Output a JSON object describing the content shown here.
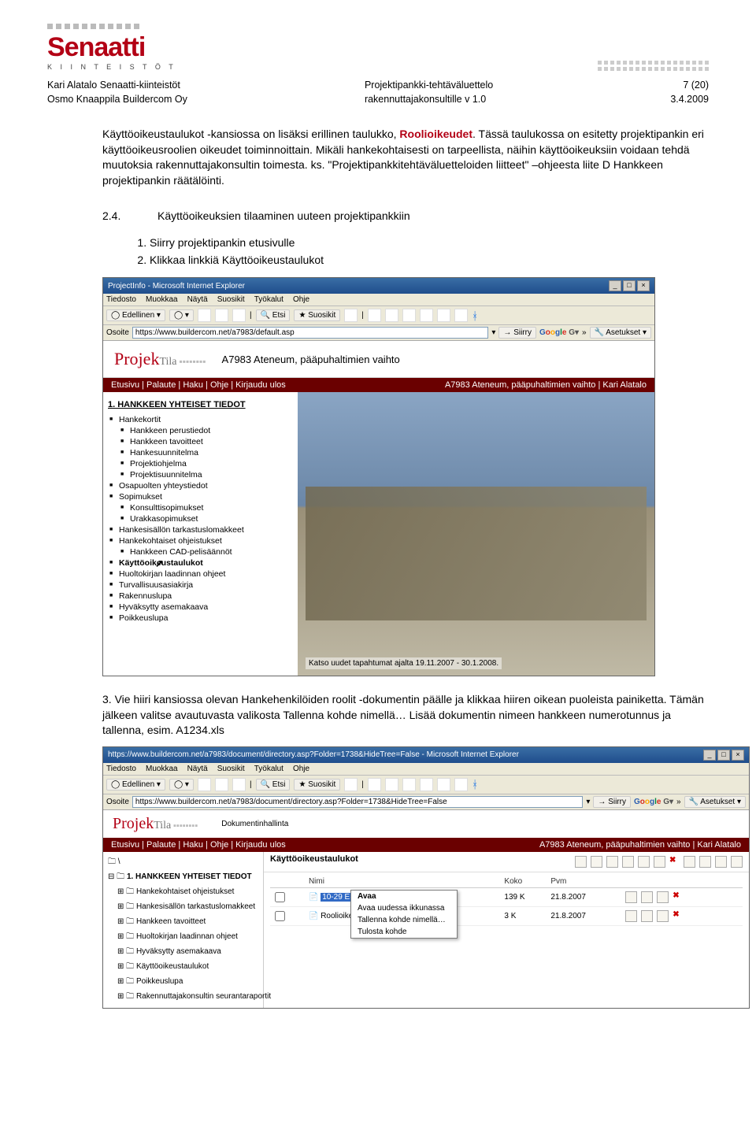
{
  "header": {
    "brand": "Senaatti",
    "brand_sub": "K I I N T E I S T Ö T",
    "meta_left_1": "Kari Alatalo Senaatti-kiinteistöt",
    "meta_left_2": "Osmo Knaappila Buildercom Oy",
    "meta_mid_1": "Projektipankki-tehtäväluettelo",
    "meta_mid_2": "rakennuttajakonsultille v 1.0",
    "page_no": "7 (20)",
    "date": "3.4.2009"
  },
  "body": {
    "p1a": "Käyttöoikeustaulukot -kansiossa on lisäksi erillinen taulukko, ",
    "p1b": "Roolioikeudet",
    "p1c": ". Tässä taulukossa on esitetty projektipankin eri käyttöoikeusroolien oikeudet toiminnoittain. Mikäli hankekohtaisesti on tarpeellista, näihin käyttöoikeuksiin voidaan tehdä muutoksia rakennuttajakonsultin toimesta. ks. \"Projektipankkitehtäväluetteloiden liitteet\" –ohjeesta liite D Hankkeen projektipankin räätälöinti.",
    "h24_num": "2.4.",
    "h24_txt": "Käyttöoikeuksien tilaaminen uuteen projektipankkiin",
    "li1": "Siirry projektipankin etusivulle",
    "li2": "Klikkaa linkkiä Käyttöoikeustaulukot",
    "li3a": "Vie hiiri kansiossa olevan ",
    "li3b": "Hankehenkilöiden roolit",
    "li3c": " -dokumentin päälle ja klikkaa hiiren oikean puoleista painiketta. Tämän jälkeen valitse avautuvasta valikosta Tallenna kohde nimellä… Lisää dokumentin nimeen hankkeen numerotunnus ja tallenna, esim. A1234.xls"
  },
  "shot1": {
    "title": "ProjectInfo - Microsoft Internet Explorer",
    "menu": [
      "Tiedosto",
      "Muokkaa",
      "Näytä",
      "Suosikit",
      "Työkalut",
      "Ohje"
    ],
    "back": "Edellinen",
    "search": "Etsi",
    "fav": "Suosikit",
    "addr_label": "Osoite",
    "url": "https://www.buildercom.net/a7983/default.asp",
    "go": "Siirry",
    "settings": "Asetukset",
    "app_logo_a": "Projek",
    "app_logo_b": "Tila",
    "app_title": "A7983 Ateneum, pääpuhaltimien vaihto",
    "nav_left": "Etusivu | Palaute | Haku | Ohje | Kirjaudu ulos",
    "nav_right": "A7983 Ateneum, pääpuhaltimien vaihto | Kari Alatalo",
    "block_title": "1. HANKKEEN YHTEISET TIEDOT",
    "items": [
      "Hankekortit",
      "Hankkeen perustiedot",
      "Hankkeen tavoitteet",
      "Hankesuunnitelma",
      "Projektiohjelma",
      "Projektisuunnitelma",
      "Osapuolten yhteystiedot",
      "Sopimukset",
      "Konsulttisopimukset",
      "Urakkasopimukset",
      "Hankesisällön tarkastuslomakkeet",
      "Hankekohtaiset ohjeistukset",
      "Hankkeen CAD-pelisäännöt",
      "Käyttöoikeustaulukot",
      "Huoltokirjan laadinnan ohjeet",
      "Turvallisuusasiakirja",
      "Rakennuslupa",
      "Hyväksytty asemakaava",
      "Poikkeuslupa"
    ],
    "highlight": "Käyttöoikeustaulukot",
    "subs": [
      "Hankkeen perustiedot",
      "Hankkeen tavoitteet",
      "Hankesuunnitelma",
      "Projektiohjelma",
      "Projektisuunnitelma",
      "Konsulttisopimukset",
      "Urakkasopimukset",
      "Hankkeen CAD-pelisäännöt"
    ],
    "caption": "Katso uudet tapahtumat ajalta 19.11.2007 - 30.1.2008."
  },
  "shot2": {
    "title": "https://www.buildercom.net/a7983/document/directory.asp?Folder=1738&HideTree=False - Microsoft Internet Explorer",
    "url": "https://www.buildercom.net/a7983/document/directory.asp?Folder=1738&HideTree=False",
    "app_title": "Dokumentinhallinta",
    "nav_right": "A7983 Ateneum, pääpuhaltimien vaihto | Kari Alatalo",
    "tree_root": "1. HANKKEEN YHTEISET TIEDOT",
    "tree": [
      "Hankekohtaiset ohjeistukset",
      "Hankesisällön tarkastuslomakkeet",
      "Hankkeen tavoitteet",
      "Huoltokirjan laadinnan ohjeet",
      "Hyväksytty asemakaava",
      "Käyttöoikeustaulukot",
      "Poikkeuslupa",
      "Rakennuttajakonsultin seurantaraportit"
    ],
    "panel_title": "Käyttöoikeustaulukot",
    "cols": [
      "",
      "Nimi",
      "Koko",
      "Pvm"
    ],
    "rows": [
      {
        "name": "10-29 ES-U-E Taaja.xls",
        "size": "139 K",
        "date": "21.8.2007"
      },
      {
        "name": "Roolioikeudet.xls",
        "size": "3 K",
        "date": "21.8.2007"
      }
    ],
    "ctx": [
      "Avaa",
      "Avaa uudessa ikkunassa",
      "Tallenna kohde nimellä…",
      "Tulosta kohde"
    ]
  }
}
